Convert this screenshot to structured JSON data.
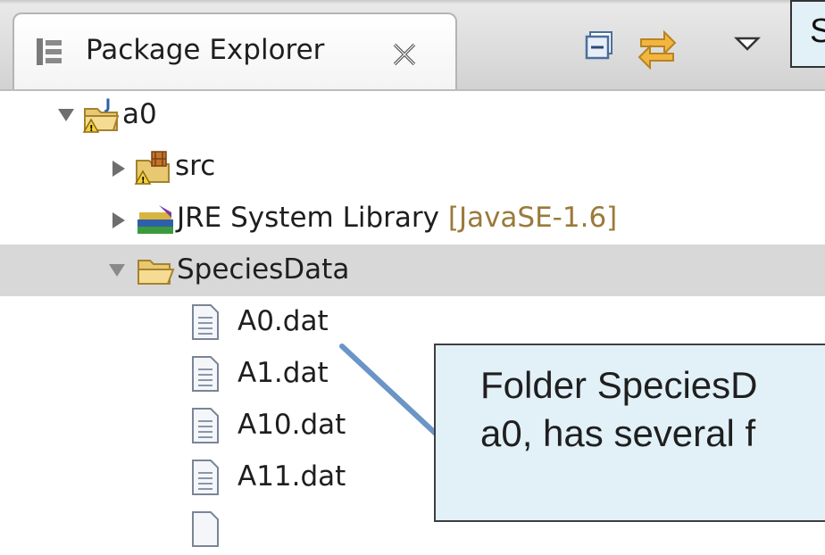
{
  "view": {
    "title": "Package Explorer",
    "icons": {
      "view": "package-explorer-icon",
      "close": "close-icon",
      "collapse_all": "collapse-all-icon",
      "link_with_editor": "link-with-editor-icon",
      "view_menu": "view-menu-icon"
    }
  },
  "tree": {
    "project": {
      "label": "a0",
      "icon": "java-project-icon"
    },
    "src": {
      "label": "src",
      "icon": "source-folder-icon"
    },
    "jre": {
      "label": "JRE System Library",
      "decoration": "[JavaSE-1.6]",
      "icon": "library-icon"
    },
    "folder": {
      "label": "SpeciesData",
      "icon": "folder-icon"
    },
    "files": [
      {
        "label": "A0.dat",
        "icon": "file-icon"
      },
      {
        "label": "A1.dat",
        "icon": "file-icon"
      },
      {
        "label": "A10.dat",
        "icon": "file-icon"
      },
      {
        "label": "A11.dat",
        "icon": "file-icon"
      }
    ]
  },
  "callouts": {
    "top_partial": "S",
    "main_line1": "Folder SpeciesD",
    "main_line2": "a0, has several f"
  },
  "colors": {
    "selection": "#d8d8d8",
    "callout_fill": "#e2f0f8",
    "pointer_line": "#6a95c6"
  }
}
